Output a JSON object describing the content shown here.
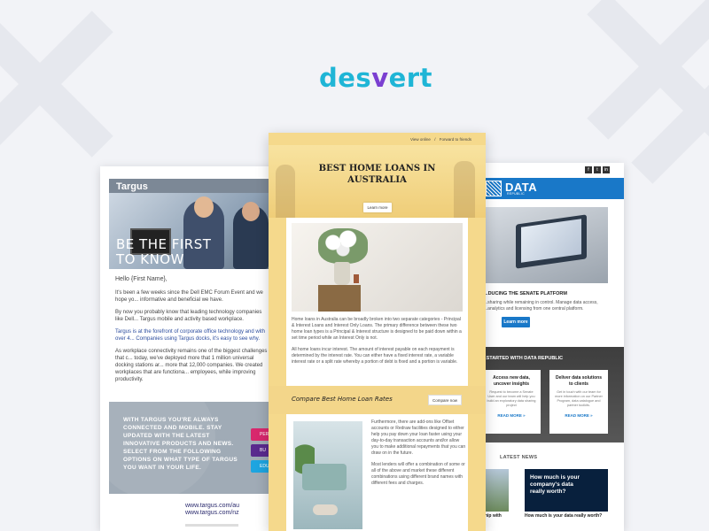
{
  "logo": {
    "prefix": "des",
    "v": "v",
    "suffix": "ert"
  },
  "colors": {
    "brand_cyan": "#1fb5d6",
    "brand_purple": "#7b3fd1",
    "targus_pink": "#d8286d",
    "targus_purple": "#5a2a8e",
    "targus_blue": "#1ea5e0",
    "data_republic_blue": "#1978c8",
    "homeloans_yellow": "#f5d98c"
  },
  "targus": {
    "logo": "Targus",
    "hero_line1": "BE THE FIRST",
    "hero_line2": "TO KNOW",
    "greeting": "Hello {First Name},",
    "p1": "It's been a few weeks since the Dell EMC Forum Event and we hope yo... informative and beneficial we have.",
    "p2": "By now you probably know that leading technology companies like Dell... Targus mobile and activity based workplace.",
    "p3": "Targus is at the forefront of corporate office technology and with over 4... Companies using Targus docks, it's easy to see why.",
    "p4": "As workplace connectivity remains one of the biggest challenges that c... today, we've deployed more that 1 million universal docking stations ar... more that 12,000 companies. We created workplaces that are functiona... employees, while improving productivity.",
    "promo": "WITH TARGUS YOU'RE ALWAYS CONNECTED AND MOBILE. STAY UPDATED WITH THE LATEST INNOVATIVE PRODUCTS AND NEWS. SELECT FROM THE FOLLOWING OPTIONS ON WHAT TYPE OF TARGUS YOU WANT IN YOUR LIFE.",
    "btn1": "PER",
    "btn2": "BU",
    "btn3": "EDUC",
    "link_au": "www.targus.com/au",
    "link_nz": "www.targus.com/nz"
  },
  "homeloans": {
    "top_link_view": "View online",
    "top_link_sep": "/",
    "top_link_forward": "Forward to friends",
    "title_line1": "BEST HOME LOANS IN",
    "title_line2": "AUSTRALIA",
    "learn_more": "Learn more",
    "p1": "Home loans in Australia can be broadly broken into two separate categories - Principal & Interest Loans and Interest Only Loans. The primary difference between these two home loan types is a Principal & Interest structure is designed to be paid down within a set time period while an Interest Only is not.",
    "p2": "All home loans incur interest. The amount of interest payable on each repayment is determined by the interest rate. You can either have a fixed interest rate, a variable interest rate or a split rate whereby a portion of debt is fixed and a portion is variable.",
    "compare_text": "Compare Best Home Loan Rates",
    "compare_btn": "Compare now",
    "p3": "Furthermore, there are add-ons like Offset accounts or Redraw facilities designed to either help you pay down your loan faster using your day-to-day transaction accounts and/or allow you to make additional repayments that you can draw on in the future.",
    "p4": "Most lenders will offer a combination of some or all of the above and market these different combinations using different brand names with different fees and charges."
  },
  "datarepublic": {
    "social1": "f",
    "social2": "t",
    "social3": "in",
    "logo": "DATA",
    "logo_sub": "REPUBLIC",
    "section_title": "...DUCING THE SENATE PLATFORM",
    "section_text": "...sharing while remaining in control. Manage data access, ...analytics and licensing from one central platform.",
    "learn_more": "Learn more",
    "started_title": "...STARTED WITH DATA REPUBLIC",
    "box1_title": "Access new data, uncover insights",
    "box1_text": "Request to become a Senate User and our team will help you build an exploratory data sharing project",
    "box1_link": "READ MORE »",
    "box2_title": "Deliver data solutions to clients",
    "box2_text": "Get in touch with our team for more information on our Partner Program, data catalogue and partner toolkits.",
    "box2_link": "READ MORE »",
    "news_title": "LATEST NEWS",
    "news1_caption": "...ship with",
    "news2_image_text": "How much is your company's data really worth?",
    "news2_caption": "How much is your data really worth?"
  }
}
